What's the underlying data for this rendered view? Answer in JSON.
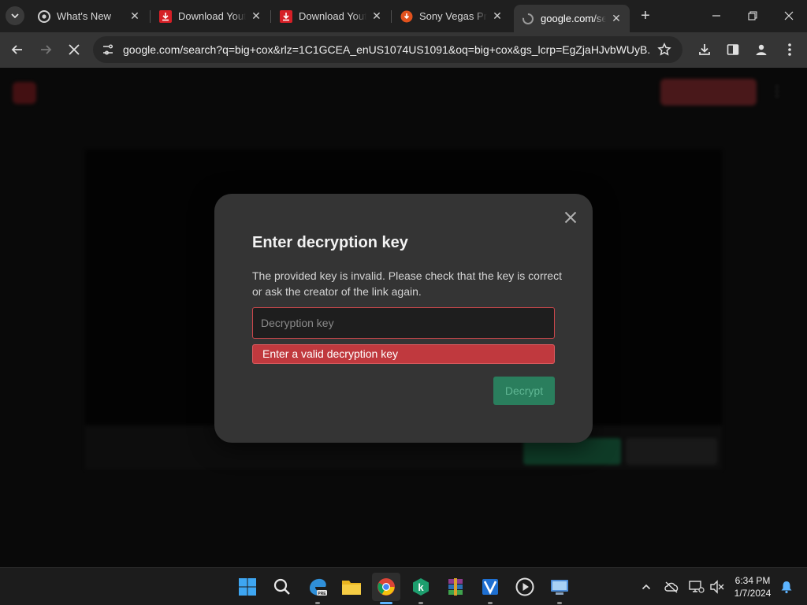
{
  "browser": {
    "tabs": [
      {
        "title": "What's New",
        "favicon": "chrome-icon",
        "active": false
      },
      {
        "title": "Download Youtube",
        "favicon": "download-red-icon",
        "active": false
      },
      {
        "title": "Download Youtube",
        "favicon": "download-red-icon",
        "active": false
      },
      {
        "title": "Sony Vegas Pro",
        "favicon": "orange-download-icon",
        "active": false
      },
      {
        "title": "google.com/search",
        "favicon": "loading-globe-icon",
        "active": true
      }
    ],
    "new_tab_label": "+",
    "address_bar": {
      "url": "google.com/search?q=big+cox&rlz=1C1GCEA_enUS1074US1091&oq=big+cox&gs_lcrp=EgZjaHJvbWUyB..."
    }
  },
  "page": {
    "modal": {
      "title": "Enter decryption key",
      "description": "The provided key is invalid. Please check that the key is correct or ask the creator of the link again.",
      "input_placeholder": "Decryption key",
      "input_value": "",
      "error_message": "Enter a valid decryption key",
      "submit_label": "Decrypt"
    }
  },
  "taskbar": {
    "pinned": [
      "start-icon",
      "search-icon",
      "edge-dev-icon",
      "file-explorer-icon",
      "chrome-icon",
      "kaspersky-icon",
      "winrar-icon",
      "vegas-icon",
      "media-player-icon",
      "remote-desktop-icon"
    ],
    "active": "chrome-icon",
    "clock": {
      "time": "6:34 PM",
      "date": "1/7/2024"
    }
  },
  "colors": {
    "accent_error": "#c0393e",
    "accent_button": "#2a7e5d",
    "modal_bg": "#343434",
    "taskbar_active": "#5cb4ff"
  }
}
